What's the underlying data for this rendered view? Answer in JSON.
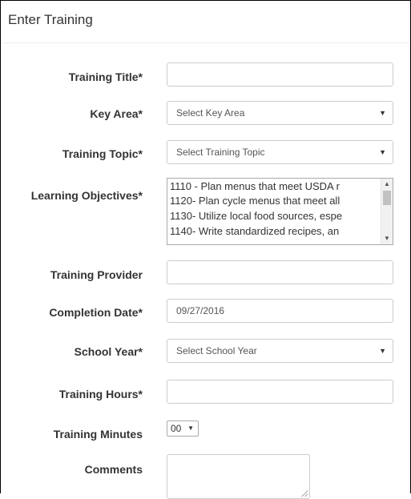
{
  "panel": {
    "title": "Enter Training"
  },
  "form": {
    "training_title": {
      "label": "Training Title*",
      "value": ""
    },
    "key_area": {
      "label": "Key Area*",
      "selected": "Select Key Area"
    },
    "training_topic": {
      "label": "Training Topic*",
      "selected": "Select Training Topic"
    },
    "learning_objectives": {
      "label": "Learning Objectives*",
      "options": [
        "1110 - Plan menus that meet USDA r",
        "1120- Plan cycle menus that meet all",
        "1130- Utilize local food sources, espe",
        "1140- Write standardized recipes, an"
      ]
    },
    "training_provider": {
      "label": "Training Provider",
      "value": ""
    },
    "completion_date": {
      "label": "Completion Date*",
      "value": "09/27/2016"
    },
    "school_year": {
      "label": "School Year*",
      "selected": "Select School Year"
    },
    "training_hours": {
      "label": "Training Hours*",
      "value": ""
    },
    "training_minutes": {
      "label": "Training Minutes",
      "selected": "00"
    },
    "comments": {
      "label": "Comments",
      "value": ""
    }
  },
  "icons": {
    "dropdown": "caret-down-icon",
    "scroll_up": "scroll-up-icon",
    "scroll_down": "scroll-down-icon"
  }
}
